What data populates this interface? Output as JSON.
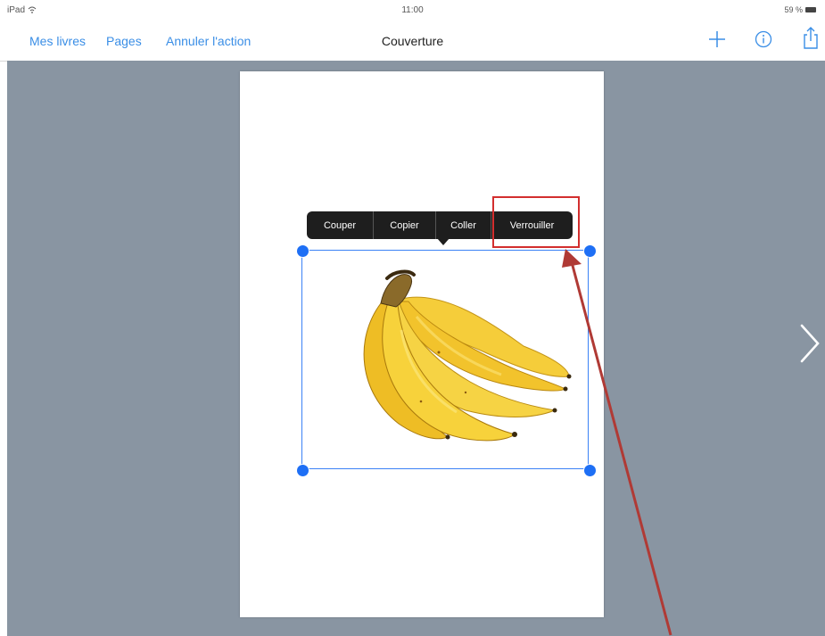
{
  "status_bar": {
    "device": "iPad",
    "time": "11:00",
    "battery": "59 %"
  },
  "nav": {
    "left_links": [
      "Mes livres",
      "Pages",
      "Annuler l'action"
    ],
    "title": "Couverture"
  },
  "icons": {
    "add": "plus-icon",
    "info": "info-icon",
    "share": "share-icon",
    "next": "chevron-right-icon",
    "wifi": "wifi-icon"
  },
  "context_menu": {
    "items": [
      "Couper",
      "Copier",
      "Coller",
      "Verrouiller"
    ],
    "highlighted": "Verrouiller"
  },
  "image": {
    "subject": "banana-bunch"
  },
  "colors": {
    "accent": "#3a8ee6",
    "selection": "#1e6ff5",
    "canvas": "#8995a2",
    "annotation": "#c0392b"
  }
}
